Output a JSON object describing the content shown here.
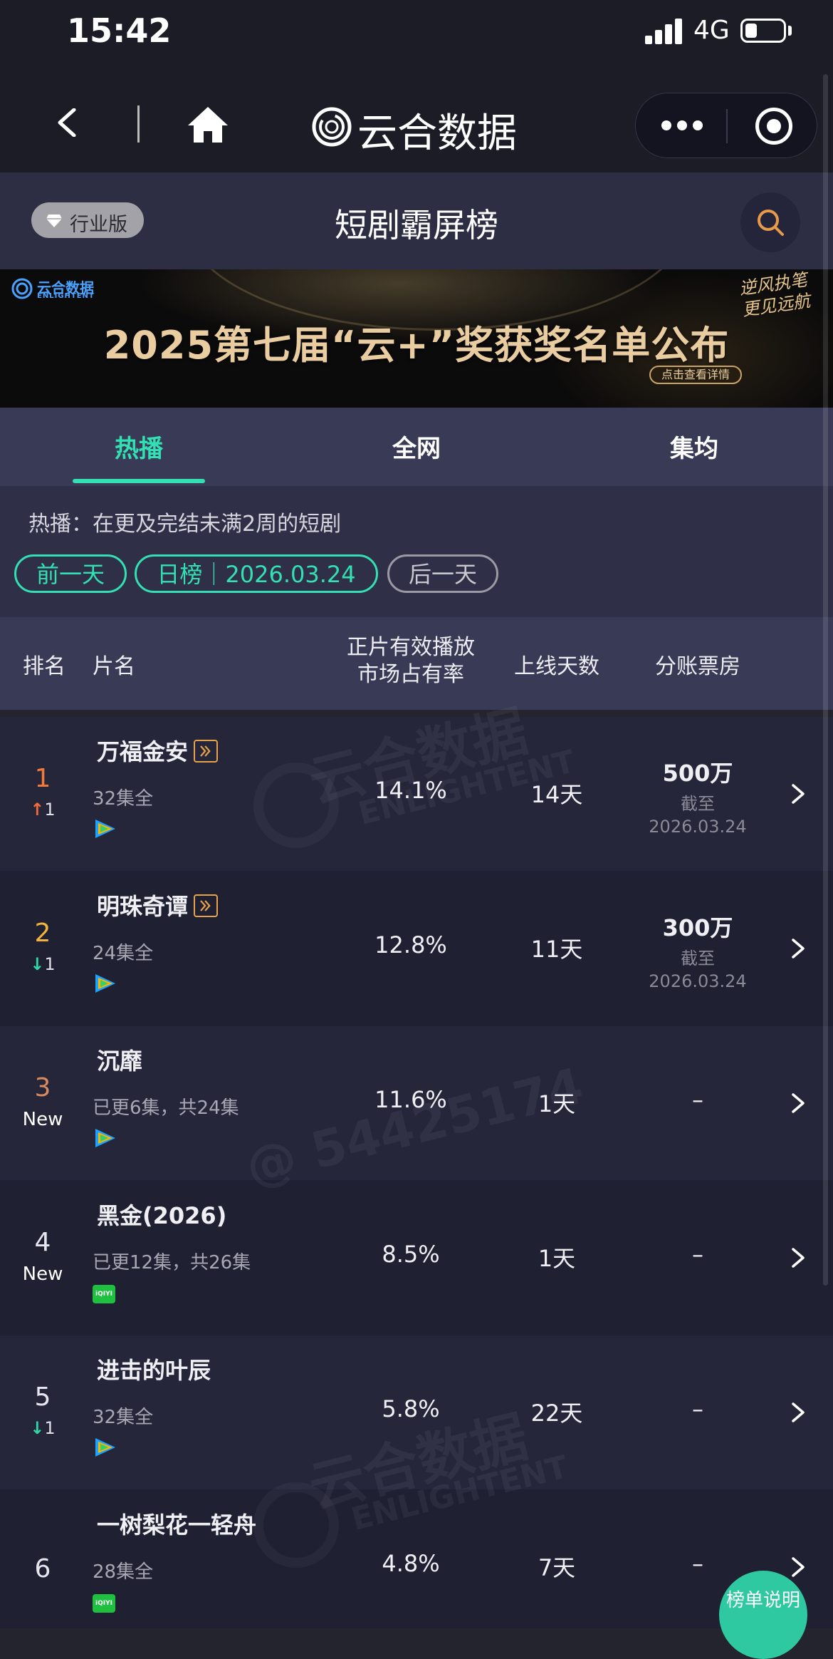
{
  "status_bar": {
    "time": "15:42",
    "network": "4G"
  },
  "nav": {
    "app_title": "云合数据"
  },
  "header": {
    "edition_badge": "行业版",
    "page_title": "短剧霸屏榜"
  },
  "banner": {
    "logo_text": "云合数据",
    "logo_sub": "ENLIGHTENT",
    "headline": "2025第七届“云+”奖获奖名单公布",
    "slogan": "逆风执笔 更见远航",
    "cta": "点击查看详情"
  },
  "tabs": [
    {
      "label": "热播",
      "active": true
    },
    {
      "label": "全网",
      "active": false
    },
    {
      "label": "集均",
      "active": false
    }
  ],
  "filter": {
    "description": "热播：在更及完结未满2周的短剧",
    "prev_day": "前一天",
    "date_pill": "日榜｜2026.03.24",
    "next_day": "后一天"
  },
  "table_header": {
    "rank": "排名",
    "title": "片名",
    "share_line1": "正片有效播放",
    "share_line2": "市场占有率",
    "days": "上线天数",
    "box_office": "分账票房"
  },
  "rows": [
    {
      "rank": "1",
      "change_dir": "up",
      "change_num": "1",
      "title": "万福金安",
      "exclusive": true,
      "episodes": "32集全",
      "platform": "tencent-video",
      "share": "14.1%",
      "days": "14天",
      "box_office": "500万",
      "asof_label": "截至",
      "asof_date": "2026.03.24",
      "rank_color": "#f07a3c"
    },
    {
      "rank": "2",
      "change_dir": "down",
      "change_num": "1",
      "title": "明珠奇谭",
      "exclusive": true,
      "episodes": "24集全",
      "platform": "tencent-video",
      "share": "12.8%",
      "days": "11天",
      "box_office": "300万",
      "asof_label": "截至",
      "asof_date": "2026.03.24",
      "rank_color": "#f2b23c"
    },
    {
      "rank": "3",
      "change_dir": "new",
      "change_label": "New",
      "title": "沉靡",
      "exclusive": false,
      "episodes": "已更6集，共24集",
      "platform": "tencent-video",
      "share": "11.6%",
      "days": "1天",
      "box_office": "–",
      "rank_color": "#d98a5e"
    },
    {
      "rank": "4",
      "change_dir": "new",
      "change_label": "New",
      "title": "黑金(2026)",
      "exclusive": false,
      "episodes": "已更12集，共26集",
      "platform": "iqiyi",
      "share": "8.5%",
      "days": "1天",
      "box_office": "–",
      "rank_color": "#e6e6ee"
    },
    {
      "rank": "5",
      "change_dir": "down",
      "change_num": "1",
      "title": "进击的叶辰",
      "exclusive": false,
      "episodes": "32集全",
      "platform": "tencent-video",
      "share": "5.8%",
      "days": "22天",
      "box_office": "–",
      "rank_color": "#e6e6ee"
    },
    {
      "rank": "6",
      "change_dir": "none",
      "title": "一树梨花一轻舟",
      "exclusive": false,
      "episodes": "28集全",
      "platform": "iqiyi",
      "share": "4.8%",
      "days": "7天",
      "box_office": "–",
      "rank_color": "#e6e6ee"
    }
  ],
  "iqiyi_label": "iQIYI",
  "watermark": {
    "logo": "云合数据",
    "sub": "ENLIGHTENT",
    "user": "@ 54425174"
  },
  "rules_button": "榜单说明",
  "colors": {
    "accent": "#32e0b4",
    "up": "#f06a3a",
    "down": "#2ed8a6",
    "exclusive": "#e8a34a"
  }
}
